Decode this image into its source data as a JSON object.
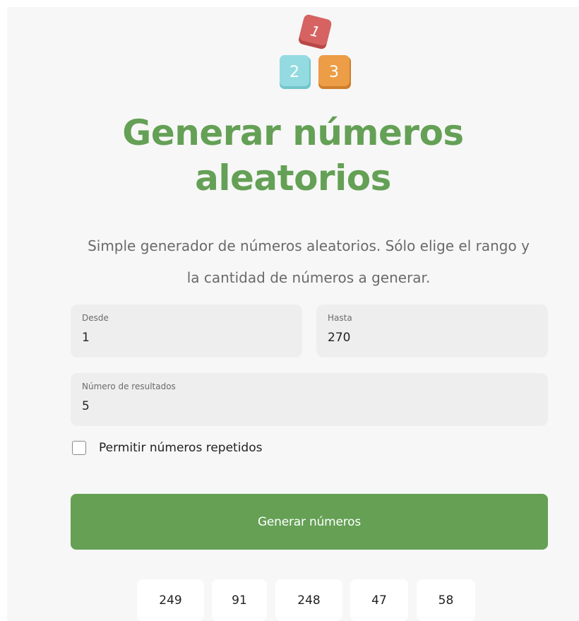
{
  "header": {
    "logo_digits": [
      "1",
      "2",
      "3"
    ],
    "title_line1": "Generar números",
    "title_line2": "aleatorios",
    "subtitle_line1": "Simple generador de números aleatorios. Sólo elige el rango y",
    "subtitle_line2": "la cantidad de números a generar."
  },
  "form": {
    "desde": {
      "label": "Desde",
      "value": "1"
    },
    "hasta": {
      "label": "Hasta",
      "value": "270"
    },
    "resultados": {
      "label": "Número de resultados",
      "value": "5"
    },
    "repetidos": {
      "label": "Permitir números repetidos",
      "checked": false
    },
    "submit_label": "Generar números"
  },
  "results": [
    "249",
    "91",
    "248",
    "47",
    "58"
  ],
  "colors": {
    "accent": "#65a055",
    "cube_red": "#d35f5f",
    "cube_blue": "#8fd9df",
    "cube_orange": "#eb9d45"
  }
}
